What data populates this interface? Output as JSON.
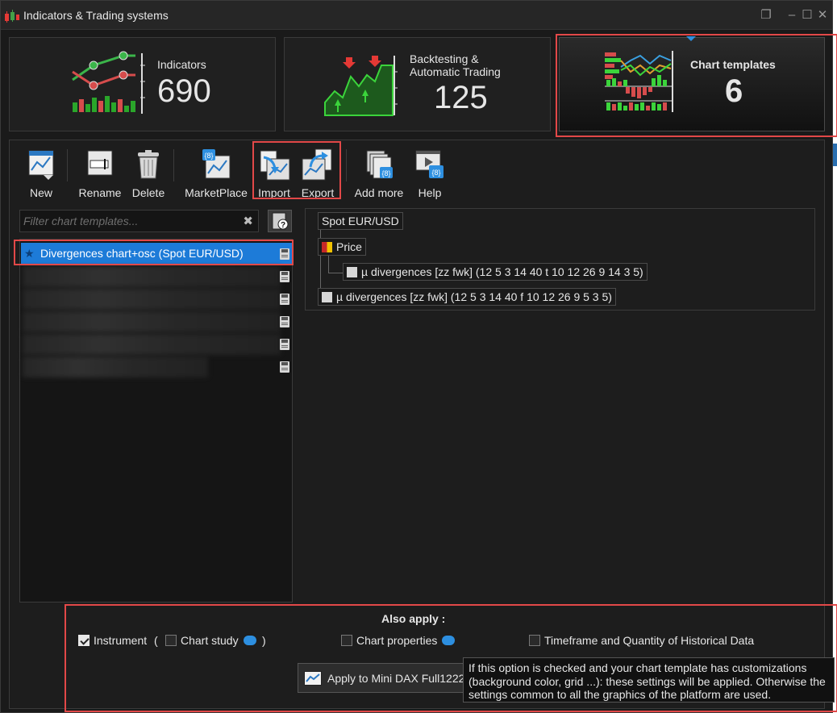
{
  "window": {
    "title": "Indicators & Trading systems"
  },
  "stats": [
    {
      "label": "Indicators",
      "value": "690"
    },
    {
      "label_line1": "Backtesting &",
      "label_line2": "Automatic Trading",
      "value": "125"
    },
    {
      "label": "Chart templates",
      "value": "6"
    }
  ],
  "toolbar": {
    "new": "New",
    "rename": "Rename",
    "delete": "Delete",
    "marketplace": "MarketPlace",
    "import": "Import",
    "export": "Export",
    "add_more": "Add more",
    "help": "Help"
  },
  "filter": {
    "placeholder": "Filter chart templates...",
    "value": ""
  },
  "templates": [
    {
      "name": "Divergences chart+osc (Spot EUR/USD)",
      "selected": true
    }
  ],
  "tree": {
    "instrument": "Spot EUR/USD",
    "price": "Price",
    "child_indicator": "µ divergences [zz fwk] (12 5 3 14 40 t 10 12 26 9 14 3 5)",
    "indicator": "µ divergences [zz fwk] (12 5 3 14 40 f 10 12 26 9 5 3 5)"
  },
  "apply": {
    "title": "Also apply :",
    "instrument": "Instrument",
    "open_paren": "(",
    "chart_study": "Chart study",
    "close_paren": ")",
    "chart_properties": "Chart properties",
    "timeframe": "Timeframe and Quantity of Historical Data",
    "button": "Apply to Mini DAX Full1222",
    "tooltip": "If this option is checked and your chart template has customizations (background color, grid ...): these settings will be applied. Otherwise the settings common to all the graphics of the platform are used."
  },
  "colors": {
    "accent": "#1d7bd8",
    "highlight": "#e24848"
  }
}
